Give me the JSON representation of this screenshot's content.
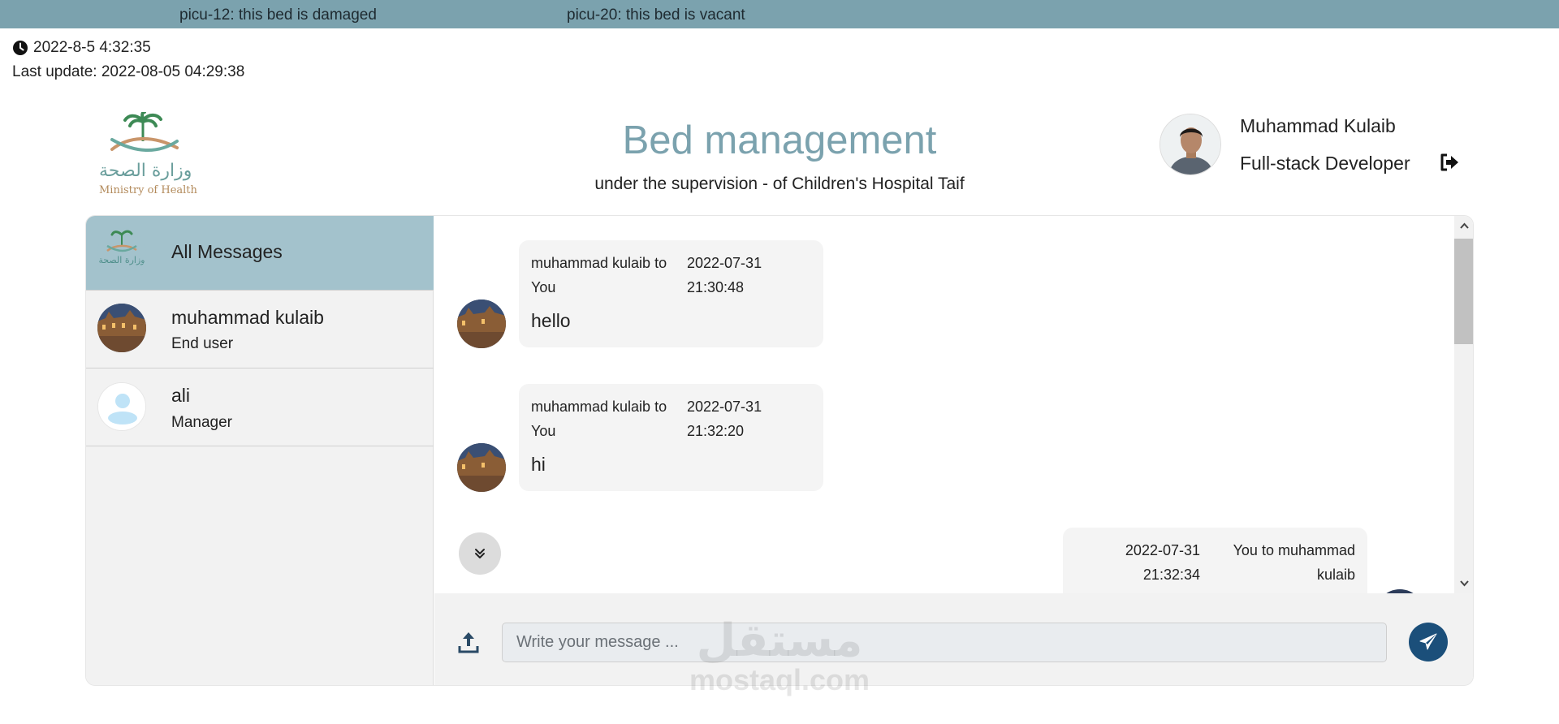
{
  "ticker": {
    "item1": "picu-12: this bed is damaged",
    "item2": "picu-20: this bed is vacant"
  },
  "status": {
    "clock": "2022-8-5 4:32:35",
    "last_update": "Last update: 2022-08-05 04:29:38"
  },
  "logo": {
    "arabic": "وزارة الصحة",
    "english": "Ministry of Health"
  },
  "header": {
    "title": "Bed management",
    "subtitle": "under the supervision - of Children's Hospital Taif"
  },
  "profile": {
    "name": "Muhammad Kulaib",
    "role": "Full-stack Developer"
  },
  "contacts": [
    {
      "name": "All Messages",
      "role": ""
    },
    {
      "name": "muhammad kulaib",
      "role": "End user"
    },
    {
      "name": "ali",
      "role": "Manager"
    }
  ],
  "messages": [
    {
      "from": "muhammad kulaib to You",
      "from_line1": "muhammad kulaib to",
      "from_line2": "You",
      "date": "2022-07-31",
      "time": "21:30:48",
      "text": "hello"
    },
    {
      "from": "muhammad kulaib to You",
      "from_line1": "muhammad kulaib to",
      "from_line2": "You",
      "date": "2022-07-31",
      "time": "21:32:20",
      "text": "hi"
    },
    {
      "from": "You to muhammad kulaib",
      "from_line1": "You to muhammad",
      "from_line2": "kulaib",
      "date": "2022-07-31",
      "time": "21:32:34",
      "text": ""
    }
  ],
  "composer": {
    "placeholder": "Write your message ..."
  },
  "watermark": {
    "arabic": "مستقل",
    "english": "mostaql.com"
  },
  "colors": {
    "ticker_bg": "#7ba2ae",
    "title": "#7ba2ae",
    "active_contact": "#a3c2cc",
    "send_button": "#1b4f7a"
  }
}
